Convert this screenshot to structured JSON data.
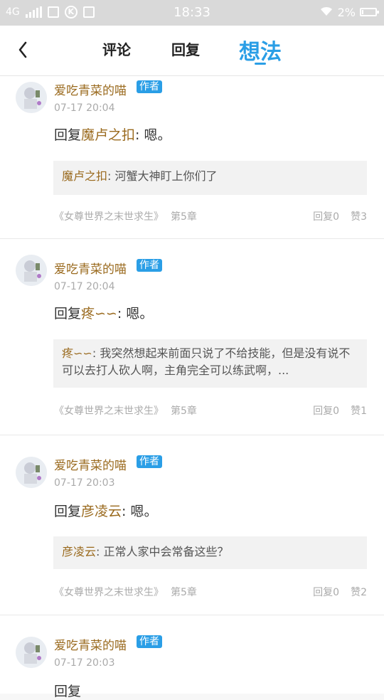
{
  "statusbar": {
    "network": "4G",
    "time": "18:33",
    "battery": "2%"
  },
  "nav": {
    "tabs": [
      "评论",
      "回复",
      "想法"
    ],
    "active_tab": "想法"
  },
  "items": [
    {
      "user": "爱吃青菜的喵",
      "badge": "作者",
      "date": "07-17 20:04",
      "reply_prefix": "回复",
      "reply_to": "魔卢之扣",
      "reply_sep": ": ",
      "reply_text": "嗯。",
      "quote_user": "魔卢之扣",
      "quote_sep": ": ",
      "quote_text": "河蟹大神盯上你们了",
      "book": "《女尊世界之末世求生》",
      "chapter": "第5章",
      "replies": "回复0",
      "likes": "赞3"
    },
    {
      "user": "爱吃青菜的喵",
      "badge": "作者",
      "date": "07-17 20:04",
      "reply_prefix": "回复",
      "reply_to": "疼∽∽",
      "reply_sep": ": ",
      "reply_text": "嗯。",
      "quote_user": "疼∽∽",
      "quote_sep": ": ",
      "quote_text": "我突然想起来前面只说了不给技能，但是没有说不可以去打人砍人啊，主角完全可以练武啊，...",
      "book": "《女尊世界之末世求生》",
      "chapter": "第5章",
      "replies": "回复0",
      "likes": "赞1"
    },
    {
      "user": "爱吃青菜的喵",
      "badge": "作者",
      "date": "07-17 20:03",
      "reply_prefix": "回复",
      "reply_to": "彦凌云",
      "reply_sep": ": ",
      "reply_text": "嗯。",
      "quote_user": "彦凌云",
      "quote_sep": ": ",
      "quote_text": "正常人家中会常备这些？",
      "book": "《女尊世界之末世求生》",
      "chapter": "第5章",
      "replies": "回复0",
      "likes": "赞2"
    },
    {
      "user": "爱吃青菜的喵",
      "badge": "作者",
      "date": "07-17 20:03",
      "reply_prefix": "回复",
      "reply_to": "",
      "reply_sep": "",
      "reply_text": "",
      "quote_user": "",
      "quote_sep": "",
      "quote_text": "",
      "book": "",
      "chapter": "",
      "replies": "",
      "likes": ""
    }
  ]
}
